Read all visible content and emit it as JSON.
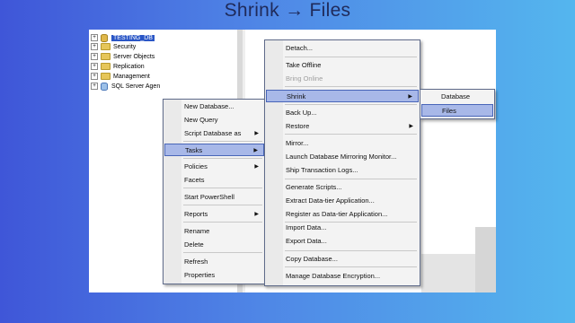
{
  "slide": {
    "title": "Shrink → Files"
  },
  "tree": {
    "items": [
      {
        "label": "TESTING_DB",
        "expander": "+",
        "icon": "database-icon"
      },
      {
        "label": "Security",
        "expander": "+",
        "icon": "folder-icon"
      },
      {
        "label": "Server Objects",
        "expander": "+",
        "icon": "folder-icon"
      },
      {
        "label": "Replication",
        "expander": "+",
        "icon": "folder-icon"
      },
      {
        "label": "Management",
        "expander": "+",
        "icon": "folder-icon"
      },
      {
        "label": "SQL Server Agen",
        "expander": "+",
        "icon": "agent-icon"
      }
    ]
  },
  "context_menu": {
    "items": [
      {
        "label": "New Database..."
      },
      {
        "label": "New Query"
      },
      {
        "label": "Script Database as",
        "submenu": true
      },
      {
        "label": "Tasks",
        "submenu": true,
        "highlighted": true
      },
      {
        "label": "Policies",
        "submenu": true
      },
      {
        "label": "Facets"
      },
      {
        "label": "Start PowerShell"
      },
      {
        "label": "Reports",
        "submenu": true
      },
      {
        "label": "Rename"
      },
      {
        "label": "Delete"
      },
      {
        "label": "Refresh"
      },
      {
        "label": "Properties"
      }
    ]
  },
  "tasks_menu": {
    "items": [
      {
        "label": "Detach..."
      },
      {
        "label": "Take Offline"
      },
      {
        "label": "Bring Online",
        "disabled": true
      },
      {
        "label": "Shrink",
        "submenu": true,
        "highlighted": true
      },
      {
        "label": "Back Up..."
      },
      {
        "label": "Restore",
        "submenu": true
      },
      {
        "label": "Mirror..."
      },
      {
        "label": "Launch Database Mirroring Monitor..."
      },
      {
        "label": "Ship Transaction Logs..."
      },
      {
        "label": "Generate Scripts..."
      },
      {
        "label": "Extract Data-tier Application..."
      },
      {
        "label": "Register as Data-tier Application..."
      },
      {
        "label": "Import Data..."
      },
      {
        "label": "Export Data..."
      },
      {
        "label": "Copy Database..."
      },
      {
        "label": "Manage Database Encryption..."
      }
    ]
  },
  "shrink_menu": {
    "items": [
      {
        "label": "Database"
      },
      {
        "label": "Files",
        "highlighted": true
      }
    ]
  },
  "icons": {
    "submenu_arrow": "▶"
  }
}
